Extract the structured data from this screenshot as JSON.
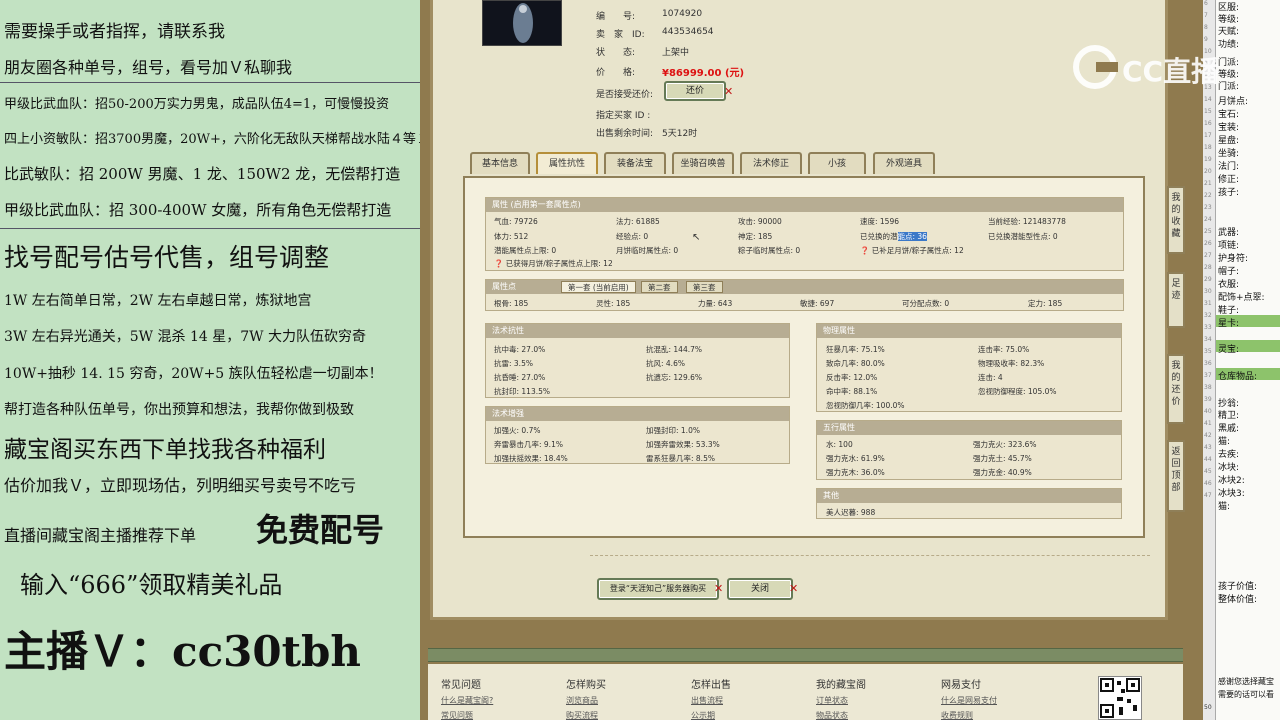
{
  "promo": {
    "lines": [
      "需要操手或者指挥，请联系我",
      "朋友圈各种单号，组号，看号加Ｖ私聊我",
      "甲级比武血队：招50-200万实力男鬼，成品队伍4=1，可慢慢投资",
      "四上小资敏队：招3700男魔，20W+，六阶化无敌队天梯帮战水陆４等１",
      "比武敏队：招 200W 男魔、1 龙、150W2 龙，无偿帮打造",
      "甲级比武血队：招 300-400W 女魔，所有角色无偿帮打造",
      "找号配号估号代售，组号调整",
      "1W 左右简单日常，2W 左右卓越日常，炼狱地宫",
      "3W 左右异光通关，5W 混杀 14 星，7W 大力队伍砍穷奇",
      "10W+抽秒 14. 15 穷奇，20W+5 族队伍轻松虐一切副本！",
      "帮打造各种队伍单号，你出预算和想法，我帮你做到极致",
      "藏宝阁买东西下单找我各种福利",
      "估价加我Ｖ，立即现场估，列明细买号卖号不吃亏",
      "直播间藏宝阁主播推荐下单",
      "免费配号",
      "输入“666”领取精美礼品",
      "主播Ｖ：cc30tbh"
    ]
  },
  "item": {
    "id_label": "编　　号:",
    "id": "1074920",
    "seller_label": "卖　家　ID:",
    "seller": "443534654",
    "status_label": "状　　态:",
    "status": "上架中",
    "price_label": "价　　格:",
    "price": "¥86999.00 (元)",
    "bargain_label": "是否接受还价:",
    "bargain_button": "还价",
    "buyer_label": "指定买家 ID :",
    "time_label": "出售剩余时间:",
    "time": "5天12时"
  },
  "tabs": [
    "基本信息",
    "属性抗性",
    "装备法宝",
    "坐骑召唤兽",
    "法术修正",
    "小孩",
    "外观道具"
  ],
  "attr": {
    "header": "属性 (启用第一套属性点)",
    "r1": [
      "气血: 79726",
      "法力: 61885",
      "攻击: 90000",
      "速度: 1596",
      "当前经验: 121483778"
    ],
    "r2": [
      "体力: 512",
      "经验点: 0",
      "神定: 185"
    ],
    "r2_hl_pre": "已兑换的潜",
    "r2_hl": "能点: 36",
    "r2_last": "已兑换潜能型性点: 0",
    "r3": [
      "潜能属性点上限: 0",
      "月饼临时属性点: 0",
      "粽子临时属性点: 0",
      "已补足月饼/粽子属性点: 12"
    ],
    "r4": "已获得月饼/粽子属性点上限: 12"
  },
  "points": {
    "header": "属性点",
    "subtabs": [
      "第一套 (当前启用)",
      "第二套",
      "第三套"
    ],
    "row": [
      "根骨: 185",
      "灵性: 185",
      "力量: 643",
      "敏捷: 697",
      "可分配点数: 0",
      "定力: 185"
    ]
  },
  "resist": {
    "header": "法术抗性",
    "cells": [
      "抗中毒: 27.0%",
      "抗混乱: 144.7%",
      "抗雷: 3.5%",
      "抗风: 4.6%",
      "抗昏睡: 27.0%",
      "抗遗忘: 129.6%",
      "抗封印: 113.5%"
    ]
  },
  "enhance": {
    "header": "法术增强",
    "cells": [
      "加强火: 0.7%",
      "加强封印: 1.0%",
      "奔雷暴击几率: 9.1%",
      "加强奔雷效果: 53.3%",
      "加强扶摇效果: 18.4%",
      "雷系狂暴几率: 8.5%"
    ]
  },
  "physical": {
    "header": "物理属性",
    "cells": [
      "狂暴几率: 75.1%",
      "连击率: 75.0%",
      "致命几率: 80.0%",
      "物理吸收率: 82.3%",
      "反击率: 12.0%",
      "连击: 4",
      "命中率: 88.1%",
      "忽视防御程度: 105.0%",
      "忽视防御几率: 100.0%"
    ]
  },
  "five": {
    "header": "五行属性",
    "cells": [
      "水: 100",
      "强力克火: 323.6%",
      "强力克水: 61.9%",
      "强力克土: 45.7%",
      "强力克木: 36.0%",
      "强力克金: 40.9%"
    ]
  },
  "other": {
    "header": "其他",
    "cells": [
      "美人迟暮: 988"
    ]
  },
  "buttons": {
    "login": "登录“天涯知己”服务器购买",
    "close": "关闭"
  },
  "vbtns": [
    "我的收藏",
    "足迹",
    "我的还价",
    "返回顶部"
  ],
  "footer": {
    "cols": [
      {
        "title": "常见问题",
        "links": [
          "什么是藏宝阁?",
          "常见问题"
        ]
      },
      {
        "title": "怎样购买",
        "links": [
          "浏览商品",
          "购买流程"
        ]
      },
      {
        "title": "怎样出售",
        "links": [
          "出售流程",
          "公示期"
        ]
      },
      {
        "title": "我的藏宝阁",
        "links": [
          "订单状态",
          "物品状态"
        ]
      },
      {
        "title": "网易支付",
        "links": [
          "什么是网易支付",
          "收费规则"
        ]
      }
    ]
  },
  "logo": "CC直播",
  "right": {
    "labels": [
      "区服:",
      "等级:",
      "天赋:",
      "功绩:",
      "",
      "门派:",
      "等级:",
      "门派:",
      "",
      "月饼点:",
      "宝石:",
      "宝装:",
      "星盘:",
      "坐骑:",
      "法门:",
      "修正:",
      "孩子:",
      "",
      "",
      "武器:",
      "项链:",
      "护身符:",
      "帽子:",
      "衣服:",
      "配饰+点翠:",
      "鞋子:",
      "星卡:",
      "",
      "灵宝:",
      "",
      "仓库物品:",
      "",
      "",
      "抄翁:",
      "精卫:",
      "黑戚:",
      "猫:",
      "去疾:",
      "冰块:",
      "冰块2:",
      "冰块3:",
      "猫:"
    ],
    "bottom1": "孩子价值:",
    "bottom2": "整体价值:",
    "chat1": "感谢您选择藏宝",
    "chat2": "需要的话可以看",
    "page_no": "50"
  }
}
